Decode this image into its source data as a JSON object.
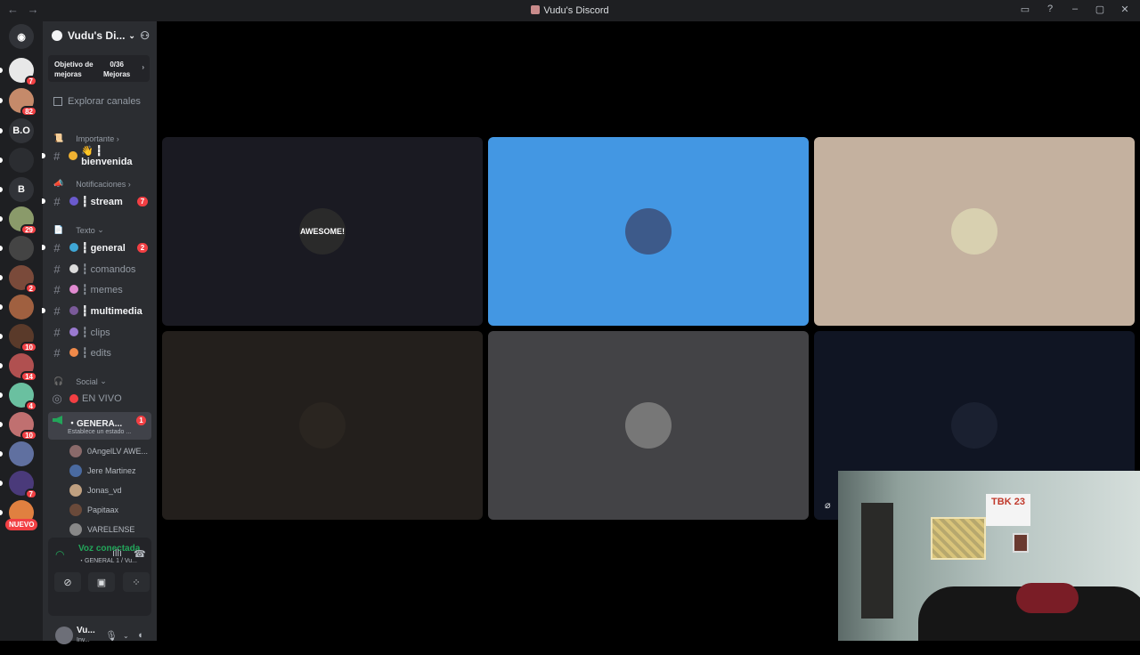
{
  "window": {
    "title": "Vudu's Discord"
  },
  "titlebar": {
    "back": "←",
    "forward": "→",
    "inbox_icon": "inbox-icon",
    "help_icon": "?",
    "minimize": "–",
    "maximize": "▢",
    "close": "✕"
  },
  "servers": [
    {
      "label": "",
      "badge": "7",
      "color": "#e8e8e8"
    },
    {
      "label": "",
      "badge": "82",
      "color": "#c58a6a"
    },
    {
      "label": "B.O",
      "badge": "",
      "color": "#313338"
    },
    {
      "label": "",
      "badge": "",
      "color": "#2b2d31"
    },
    {
      "label": "B",
      "badge": "",
      "color": "#313338"
    },
    {
      "label": "",
      "badge": "29",
      "color": "#8a9a6a"
    },
    {
      "label": "",
      "badge": "",
      "color": "#444"
    },
    {
      "label": "",
      "badge": "2",
      "color": "#7a4a3a"
    },
    {
      "label": "",
      "badge": "",
      "color": "#a06040"
    },
    {
      "label": "",
      "badge": "10",
      "color": "#5a3a2a"
    },
    {
      "label": "",
      "badge": "14",
      "color": "#b05050"
    },
    {
      "label": "",
      "badge": "4",
      "color": "#6ac0a0"
    },
    {
      "label": "",
      "badge": "10",
      "color": "#c07070"
    },
    {
      "label": "",
      "badge": "",
      "color": "#6070a0"
    },
    {
      "label": "",
      "badge": "7",
      "color": "#4a3a7a"
    },
    {
      "label": "",
      "badge": "",
      "color": "#e08040"
    }
  ],
  "nuevo": "NUEVO",
  "server_header": {
    "name": "Vudu's Di...",
    "chevron": "⌄",
    "invite_icon": "add-member-icon"
  },
  "boost": {
    "label": "Objetivo de mejoras",
    "count": "0/36",
    "unit": "Mejoras",
    "arrow": "›"
  },
  "explore": "Explorar canales",
  "categories": {
    "importante": {
      "label": "Importante",
      "emoji": "📜",
      "chev": "›"
    },
    "notificaciones": {
      "label": "Notificaciones",
      "emoji": "📣",
      "chev": "›"
    },
    "texto": {
      "label": "Texto",
      "emoji": "📄",
      "chev": "⌄"
    },
    "social": {
      "label": "Social",
      "emoji": "🎧",
      "chev": "⌄"
    }
  },
  "channels": [
    {
      "name": "👋 ┇ bienvenida",
      "bold": true,
      "badge": ""
    },
    {
      "name": "┇ stream",
      "bold": true,
      "badge": "7"
    },
    {
      "name": "┇ general",
      "bold": true,
      "badge": "2"
    },
    {
      "name": "┇ comandos",
      "bold": false,
      "badge": ""
    },
    {
      "name": "┇ memes",
      "bold": false,
      "badge": ""
    },
    {
      "name": "┇ multimedia",
      "bold": true,
      "badge": ""
    },
    {
      "name": "┇ clips",
      "bold": false,
      "badge": ""
    },
    {
      "name": "┇ edits",
      "bold": false,
      "badge": ""
    }
  ],
  "live_channel": "EN VIVO",
  "voice_channel": {
    "name": "・GENERA...",
    "status": "Establece un estado ...",
    "badge": "1"
  },
  "members": [
    "0AngelLV AWE...",
    "Jere Martinez",
    "Jonas_vd",
    "Papitaax",
    "VARELENSE"
  ],
  "voice_panel": {
    "title": "Voz conectada",
    "subtitle": "・GENERAL 1 / Vu..."
  },
  "user": {
    "name": "Vu...",
    "status": "Inv..."
  },
  "tiles": [
    {
      "bg": "#1a1a22",
      "avatar_bg": "#2a2a2a",
      "avatar_text": "AWESOME!"
    },
    {
      "bg": "#4397e3",
      "avatar_bg": "#3d5a8a",
      "avatar_text": ""
    },
    {
      "bg": "#c4b19f",
      "avatar_bg": "#d8d0b0",
      "avatar_text": ""
    },
    {
      "bg": "#231f1c",
      "avatar_bg": "#2a2520",
      "avatar_text": ""
    },
    {
      "bg": "#434346",
      "avatar_bg": "#777",
      "avatar_text": ""
    },
    {
      "bg": "#101523",
      "avatar_bg": "#1a2030",
      "avatar_text": ""
    }
  ],
  "camera": {
    "sign_text": "TBK 23"
  }
}
